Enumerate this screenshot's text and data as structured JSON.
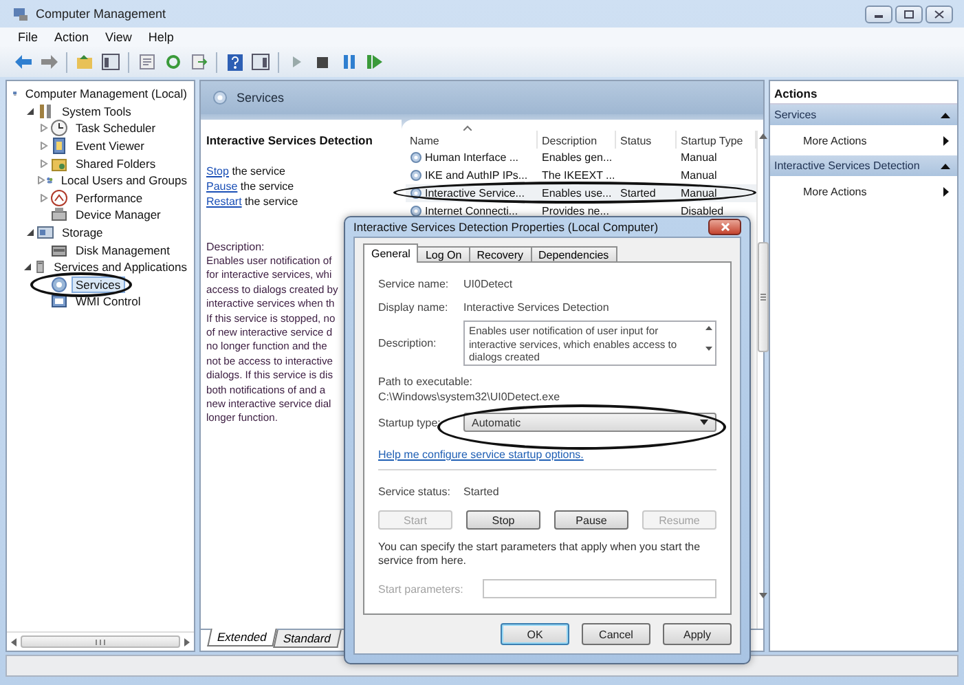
{
  "window": {
    "title": "Computer Management"
  },
  "menu": [
    "File",
    "Action",
    "View",
    "Help"
  ],
  "tree": [
    {
      "label": "Computer Management (Local)",
      "selected": false,
      "children": [
        {
          "label": "System Tools",
          "expanded": true,
          "selected": false,
          "children": [
            {
              "label": "Task Scheduler",
              "expanded": false,
              "selected": false
            },
            {
              "label": "Event Viewer",
              "expanded": false,
              "selected": false
            },
            {
              "label": "Shared Folders",
              "expanded": false,
              "selected": false
            },
            {
              "label": "Local Users and Groups",
              "expanded": false,
              "selected": false
            },
            {
              "label": "Performance",
              "expanded": false,
              "selected": false
            },
            {
              "label": "Device Manager",
              "selected": false
            }
          ]
        },
        {
          "label": "Storage",
          "expanded": true,
          "selected": false,
          "children": [
            {
              "label": "Disk Management",
              "selected": false
            }
          ]
        },
        {
          "label": "Services and Applications",
          "expanded": true,
          "selected": false,
          "children": [
            {
              "label": "Services",
              "selected": true
            },
            {
              "label": "WMI Control",
              "selected": false
            }
          ]
        }
      ]
    }
  ],
  "middle": {
    "header": "Services",
    "detail": {
      "title": "Interactive Services Detection",
      "actions": [
        {
          "link": "Stop",
          "text": "the service"
        },
        {
          "link": "Pause",
          "text": "the service"
        },
        {
          "link": "Restart",
          "text": "the service"
        }
      ],
      "description_label": "Description:",
      "description_lines": [
        "Enables user notification of",
        "for interactive services, whi",
        "access to dialogs created by",
        "interactive services when th",
        "If this service is stopped, no",
        "of new interactive service d",
        "no longer function and the",
        "not be access to interactive",
        "dialogs. If this service is dis",
        "both notifications of and a",
        "new interactive service dial",
        "longer function."
      ]
    },
    "list": {
      "columns": [
        "Name",
        "Description",
        "Status",
        "Startup Type"
      ],
      "rows": [
        {
          "name": "Human Interface ...",
          "description": "Enables gen...",
          "startup": "Manual",
          "selected": false
        },
        {
          "name": "IKE and AuthIP IPs...",
          "description": "The IKEEXT ...",
          "startup": "Manual",
          "selected": false
        },
        {
          "name": "Interactive Service...",
          "description": "Enables use...",
          "status": "Started",
          "startup": "Manual",
          "selected": true
        },
        {
          "name": "Internet Connecti...",
          "description": "Provides ne...",
          "startup": "Disabled",
          "selected": false
        }
      ]
    },
    "view_tabs": [
      {
        "label": "Extended",
        "selected": true
      },
      {
        "label": "Standard",
        "selected": false
      }
    ]
  },
  "actions": {
    "title": "Actions",
    "sections": [
      {
        "title": "Services",
        "expanded": true,
        "items": [
          "More Actions"
        ]
      },
      {
        "title": "Interactive Services Detection",
        "expanded": true,
        "items": [
          "More Actions"
        ]
      }
    ]
  },
  "dialog": {
    "title": "Interactive Services Detection Properties (Local Computer)",
    "tabs": [
      {
        "label": "General",
        "selected": true
      },
      {
        "label": "Log On",
        "selected": false
      },
      {
        "label": "Recovery",
        "selected": false
      },
      {
        "label": "Dependencies",
        "selected": false
      }
    ],
    "service_name": {
      "label": "Service name:",
      "value": "UI0Detect"
    },
    "display_name": {
      "label": "Display name:",
      "value": "Interactive Services Detection"
    },
    "description": {
      "label": "Description:",
      "value": "Enables user notification of user input for interactive services, which enables access to dialogs created"
    },
    "path": {
      "label": "Path to executable:",
      "value": "C:\\Windows\\system32\\UI0Detect.exe"
    },
    "startup_type": {
      "label": "Startup type:",
      "value": "Automatic"
    },
    "help_link": "Help me configure service startup options.",
    "status": {
      "label": "Service status:",
      "value": "Started"
    },
    "service_buttons": [
      {
        "label": "Start",
        "disabled": true
      },
      {
        "label": "Stop",
        "disabled": false
      },
      {
        "label": "Pause",
        "disabled": false
      },
      {
        "label": "Resume",
        "disabled": true
      }
    ],
    "note": "You can specify the start parameters that apply when you start the service from here.",
    "start_parameters": {
      "label": "Start parameters:",
      "disabled": true
    },
    "buttons": [
      {
        "label": "OK",
        "default": true
      },
      {
        "label": "Cancel",
        "default": false
      },
      {
        "label": "Apply",
        "default": false
      }
    ]
  }
}
